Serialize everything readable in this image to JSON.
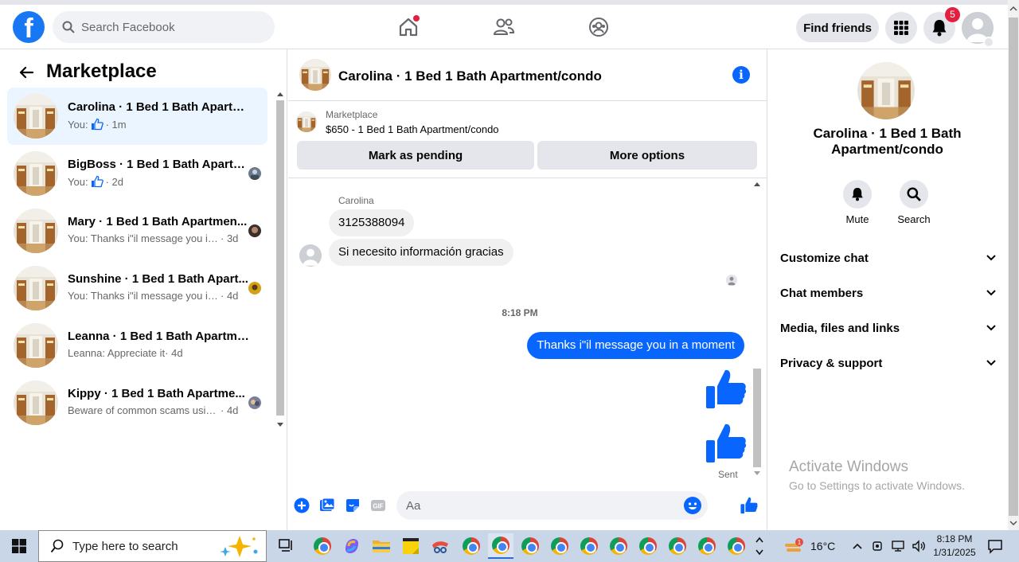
{
  "topbar": {
    "logo": "f",
    "search_placeholder": "Search Facebook",
    "find_friends": "Find friends",
    "notification_count": "5"
  },
  "left": {
    "title": "Marketplace",
    "conversations": [
      {
        "name": "Carolina · 1 Bed 1 Bath Apartme...",
        "prefix": "You:",
        "snippet": "",
        "time": "· 1m",
        "thumb_up": true
      },
      {
        "name": "BigBoss · 1 Bed 1 Bath Apartm...",
        "prefix": "You:",
        "snippet": "",
        "time": "· 2d",
        "thumb_up": true
      },
      {
        "name": "Mary · 1 Bed 1 Bath Apartmen...",
        "prefix": "",
        "snippet": "You: Thanks i\"il message you in ...",
        "time": " · 3d"
      },
      {
        "name": "Sunshine · 1 Bed 1 Bath Apart...",
        "prefix": "",
        "snippet": "You: Thanks i\"il message you in ...",
        "time": " · 4d"
      },
      {
        "name": "Leanna · 1 Bed 1 Bath Apartmen...",
        "prefix": "",
        "snippet": "Leanna: Appreciate it",
        "time": " · 4d"
      },
      {
        "name": "Kippy · 1 Bed 1 Bath Apartme...",
        "prefix": "",
        "snippet": "Beware of common scams using...",
        "time": " · 4d"
      }
    ]
  },
  "chat": {
    "title": "Carolina · 1 Bed 1 Bath Apartment/condo",
    "listing_label": "Marketplace",
    "listing_price": "$650 - 1 Bed 1 Bath Apartment/condo",
    "mark_pending": "Mark as pending",
    "more_options": "More options",
    "sender": "Carolina",
    "incoming": [
      "3125388094",
      "Si necesito información gracias"
    ],
    "timestamp": "8:18 PM",
    "outgoing": "Thanks i\"il message you in a moment",
    "sent_label": "Sent",
    "composer_placeholder": "Aa"
  },
  "right": {
    "title": "Carolina · 1 Bed 1 Bath Apartment/condo",
    "actions": [
      "Mute",
      "Search"
    ],
    "sections": [
      "Customize chat",
      "Chat members",
      "Media, files and links",
      "Privacy & support"
    ]
  },
  "watermark": {
    "line1": "Activate Windows",
    "line2": "Go to Settings to activate Windows."
  },
  "taskbar": {
    "search_placeholder": "Type here to search",
    "weather": "16°C",
    "time": "8:18 PM",
    "date": "1/31/2025"
  },
  "colors": {
    "brand": "#1877f2",
    "messenger_blue": "#0866ff",
    "active_row": "#ebf5ff",
    "badge": "#e41e3f"
  }
}
